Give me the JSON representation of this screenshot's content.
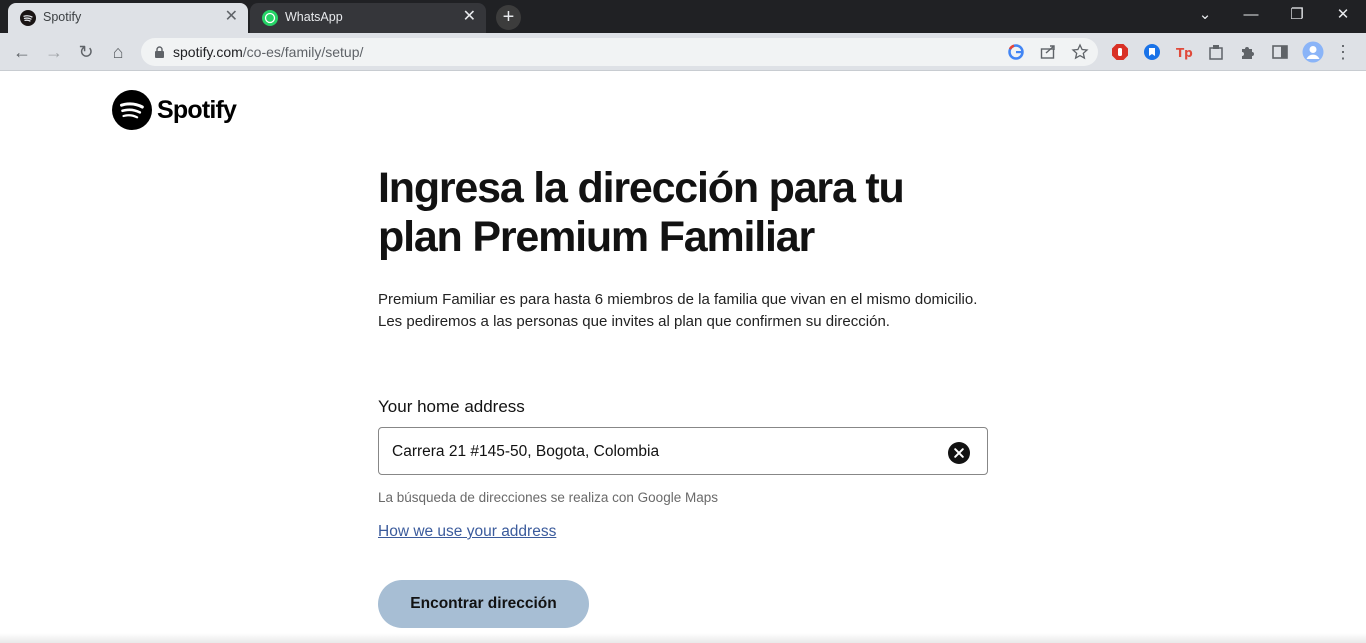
{
  "browser": {
    "tabs": [
      {
        "title": "Spotify",
        "close": "✕"
      },
      {
        "title": "WhatsApp",
        "close": "✕"
      }
    ],
    "new_tab": "+",
    "window_controls": {
      "dropdown": "⌄",
      "minimize": "—",
      "restore": "❐",
      "close": "✕"
    },
    "nav": {
      "back": "←",
      "forward": "→",
      "reload": "↻",
      "home": "⌂"
    },
    "url_host": "spotify.com",
    "url_path": "/co-es/family/setup/",
    "menu": "⋮"
  },
  "page": {
    "logo_text": "Spotify",
    "heading": "Ingresa la dirección para tu plan Premium Familiar",
    "description": "Premium Familiar es para hasta 6 miembros de la familia que vivan en el mismo domicilio. Les pediremos a las personas que invites al plan que confirmen su dirección.",
    "field_label": "Your home address",
    "address_value": "Carrera 21 #145-50, Bogota, Colombia",
    "hint": "La búsqueda de direcciones se realiza con Google Maps",
    "link_text": "How we use your address",
    "button_label": "Encontrar dirección"
  },
  "colors": {
    "chrome_dark": "#202124",
    "toolbar": "#dee1e6",
    "button_bg": "#a7bed4",
    "link": "#3b5b9c"
  }
}
